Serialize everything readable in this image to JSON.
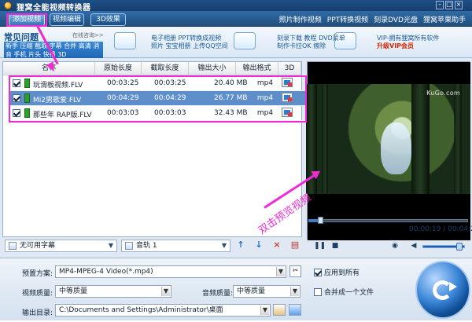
{
  "window": {
    "title": "狸窝全能视频转换器"
  },
  "toolbar": {
    "tabs": [
      "添加视频",
      "视频编辑",
      "3D效果"
    ],
    "links": [
      "照片制作视频",
      "PPT转换视频",
      "刻录DVD光盘",
      "狸窝苹果助手"
    ]
  },
  "ads": {
    "faq_title": "常见问题",
    "faq_online": "在线咨询>>",
    "faq_links": "新手 压缩 截取 字幕 合并 高清 消音 手机 片头 快播 3D",
    "ad1_line1": "电子相册 PPT转换成视频",
    "ad1_line2": "照片 宝宝相册 上传QQ空间",
    "ad2_line1": "刻录下载 教程 DVD菜单",
    "ad2_line2": "制作卡拉OK 擦除",
    "ad3_line1": "VIP-拥有狸窝所有软件",
    "ad3_line2": "升级VIP会员"
  },
  "table": {
    "headers": [
      "名称",
      "原始长度",
      "截取长度",
      "输出大小",
      "输出格式",
      "3D"
    ],
    "rows": [
      {
        "name": "玩滑板视频.FLV",
        "original_length": "00:03:25",
        "clip_length": "00:03:25",
        "output_size": "20.40 MB",
        "format": "mp4",
        "selected": false
      },
      {
        "name": "Mi2男歌爱.FLV",
        "original_length": "00:04:29",
        "clip_length": "00:04:29",
        "output_size": "26.77 MB",
        "format": "mp4",
        "selected": true
      },
      {
        "name": "那些年 RAP版.FLV",
        "original_length": "00:03:03",
        "clip_length": "00:03:03",
        "output_size": "32.43 MB",
        "format": "mp4",
        "selected": false
      }
    ]
  },
  "bottom_tools": {
    "subtitle": "无可用字幕",
    "audio": "音轨 1"
  },
  "preview": {
    "brand": "KuGo.com",
    "hint": "双击预览视频",
    "progress_percent": 8,
    "current_time": "00:00:19",
    "total_time": "00:04:29",
    "volume_percent": 85
  },
  "settings": {
    "preset_label": "预置方案:",
    "preset_value": "MP4-MPEG-4 Video(*.mp4)",
    "video_quality_label": "视频质量:",
    "video_quality_value": "中等质量",
    "audio_quality_label": "音频质量:",
    "audio_quality_value": "中等质量",
    "apply_all": "应用到所有",
    "merge_file": "合并成一个文件",
    "output_label": "输出目录:",
    "output_path": "C:\\Documents and Settings\\Administrator\\桌面"
  },
  "colors": {
    "annotation_pink": "#f02ad5",
    "selected_row": "#5f8fca",
    "brand_blue": "#1d4f87"
  }
}
